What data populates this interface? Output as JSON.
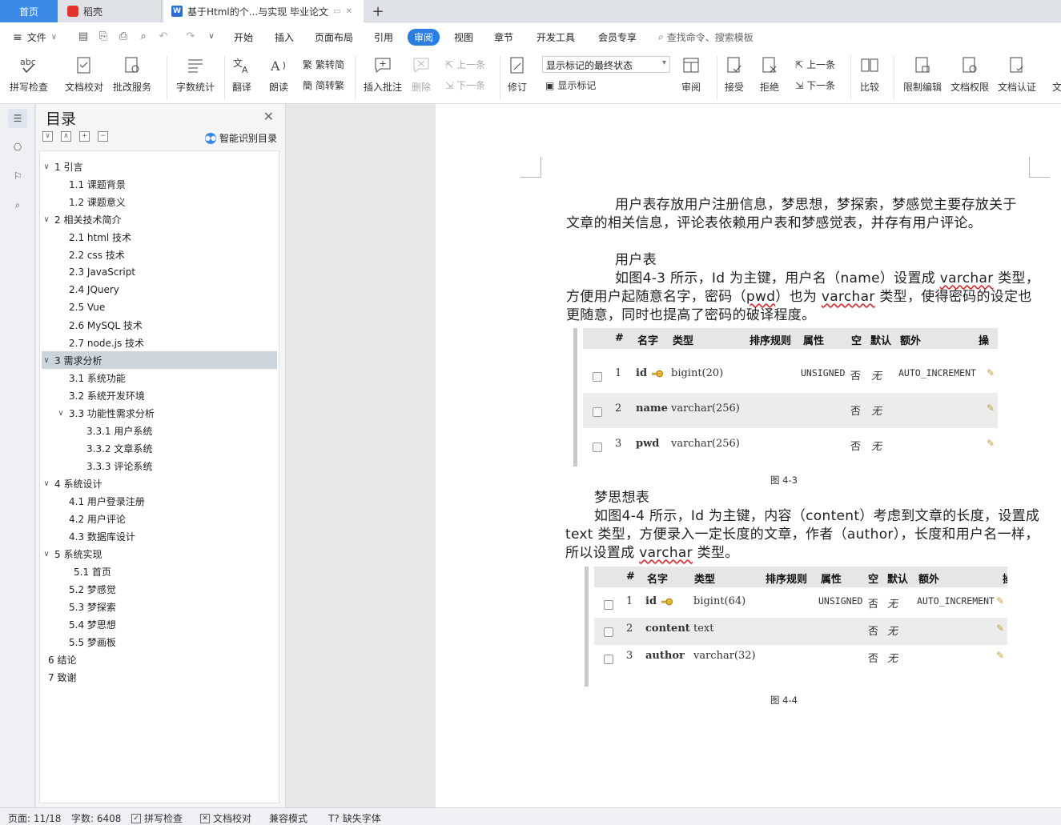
{
  "tabs": {
    "home": "首页",
    "daoke": "稻壳",
    "document": "基于Html的个...与实现 毕业论文"
  },
  "menu": {
    "file": "文件",
    "tabs": [
      "开始",
      "插入",
      "页面布局",
      "引用",
      "审阅",
      "视图",
      "章节",
      "开发工具",
      "会员专享"
    ],
    "active_tab": "审阅",
    "search": "查找命令、搜索模板"
  },
  "ribbon": {
    "spell_check": "拼写检查",
    "doc_check": "文档校对",
    "revision_service": "批改服务",
    "word_count": "字数统计",
    "translate": "翻译",
    "read_aloud": "朗读",
    "trad": "繁转简",
    "simp": "简转繁",
    "insert_comment": "插入批注",
    "delete": "删除",
    "prev": "上一条",
    "next": "下一条",
    "revise": "修订",
    "markup_state": "显示标记的最终状态",
    "show_markup": "显示标记",
    "review": "审阅",
    "accept": "接受",
    "reject": "拒绝",
    "prev2": "上一条",
    "next2": "下一条",
    "compare": "比较",
    "restrict": "限制编辑",
    "permission": "文档权限",
    "certify": "文档认证",
    "more": "文"
  },
  "toc": {
    "title": "目录",
    "smart": "智能识别目录",
    "items": [
      {
        "label": "1  引言",
        "level": 1,
        "toggle": "∨"
      },
      {
        "label": "1.1  课题背景",
        "level": 2
      },
      {
        "label": "1.2 课题意义",
        "level": 2
      },
      {
        "label": "2 相关技术简介",
        "level": 1,
        "toggle": "∨"
      },
      {
        "label": "2.1 html 技术",
        "level": 2
      },
      {
        "label": "2.2 css 技术",
        "level": 2
      },
      {
        "label": "2.3 JavaScript",
        "level": 2
      },
      {
        "label": "2.4 JQuery",
        "level": 2
      },
      {
        "label": "2.5 Vue",
        "level": 2
      },
      {
        "label": "2.6 MySQL 技术",
        "level": 2
      },
      {
        "label": "2.7 node.js 技术",
        "level": 2
      },
      {
        "label": "3 需求分析",
        "level": 1,
        "toggle": "∨",
        "selected": true
      },
      {
        "label": "3.1  系统功能",
        "level": 2
      },
      {
        "label": "3.2  系统开发环境",
        "level": 2
      },
      {
        "label": "3.3 功能性需求分析",
        "level": 2,
        "toggle": "∨"
      },
      {
        "label": "3.3.1 用户系统",
        "level": 3
      },
      {
        "label": "3.3.2  文章系统",
        "level": 3
      },
      {
        "label": "3.3.3    评论系统",
        "level": 3
      },
      {
        "label": "4  系统设计",
        "level": 1,
        "toggle": "∨"
      },
      {
        "label": "4.1  用户登录注册",
        "level": 2
      },
      {
        "label": "4.2  用户评论",
        "level": 2
      },
      {
        "label": "4.3  数据库设计",
        "level": 2
      },
      {
        "label": "5  系统实现",
        "level": 1,
        "toggle": "∨"
      },
      {
        "label": "5.1  首页",
        "level": 2,
        "indent": 1
      },
      {
        "label": "5.2  梦感觉",
        "level": 2
      },
      {
        "label": "5.3  梦探索",
        "level": 2
      },
      {
        "label": "5.4 梦思想",
        "level": 2
      },
      {
        "label": "5.5 梦画板",
        "level": 2
      },
      {
        "label": "6  结论",
        "level": 1
      },
      {
        "label": "7  致谢",
        "level": 1
      }
    ]
  },
  "doc": {
    "p1a": "用户表存放用户注册信息，梦思想，梦探索，梦感觉主要存放关于",
    "p1b": "文章的相关信息，评论表依赖用户表和梦感觉表，并存有用户评论。",
    "h_user": "用户表",
    "p2_pre": "如图",
    "p2_ref": "4-3",
    "p2_mid": "所示，",
    "p2_id": "Id",
    "p2_mid2": "为主键，用户名（",
    "p2_name": "name",
    "p2_mid3": "）设置成",
    "p2_varchar": "varchar",
    "p2_end": "类型，",
    "p3_pre": "方便用户起随意名字，密码（",
    "p3_pwd": "pwd",
    "p3_mid": "）也为",
    "p3_varchar": "varchar",
    "p3_end": "类型，使得密码的设定也",
    "p4": "更随意，同时也提高了密码的破译程度。",
    "caption1": "图 4-3",
    "h_dream": "梦思想表",
    "p5_pre": "如图",
    "p5_ref": "4-4",
    "p5_mid": "所示，",
    "p5_id": "Id",
    "p5_mid2": "为主键，内容（",
    "p5_content": "content",
    "p5_end": "）考虑到文章的长度，设置成",
    "p6_text": "text",
    "p6_mid": "类型，方便录入一定长度的文章，作者（",
    "p6_author": "author",
    "p6_end": "），长度和用户名一样，",
    "p7_pre": "所以设置成",
    "p7_varchar": "varchar",
    "p7_end": "类型。",
    "caption2": "图 4-4"
  },
  "table1": {
    "headers": [
      "#",
      "名字",
      "类型",
      "排序规则",
      "属性",
      "空",
      "默认",
      "额外",
      "操"
    ],
    "rows": [
      {
        "num": "1",
        "name": "id",
        "type": "bigint(20)",
        "attr": "UNSIGNED",
        "null": "否",
        "default": "无",
        "extra": "AUTO_INCREMENT",
        "key": true
      },
      {
        "num": "2",
        "name": "name",
        "type": "varchar(256)",
        "attr": "",
        "null": "否",
        "default": "无",
        "extra": ""
      },
      {
        "num": "3",
        "name": "pwd",
        "type": "varchar(256)",
        "attr": "",
        "null": "否",
        "default": "无",
        "extra": ""
      }
    ]
  },
  "table2": {
    "headers": [
      "#",
      "名字",
      "类型",
      "排序规则",
      "属性",
      "空",
      "默认",
      "额外",
      "操"
    ],
    "rows": [
      {
        "num": "1",
        "name": "id",
        "type": "bigint(64)",
        "attr": "UNSIGNED",
        "null": "否",
        "default": "无",
        "extra": "AUTO_INCREMENT",
        "key": true
      },
      {
        "num": "2",
        "name": "content",
        "type": "text",
        "attr": "",
        "null": "否",
        "default": "无",
        "extra": ""
      },
      {
        "num": "3",
        "name": "author",
        "type": "varchar(32)",
        "attr": "",
        "null": "否",
        "default": "无",
        "extra": ""
      }
    ]
  },
  "status": {
    "page": "页面: 11/18",
    "words": "字数: 6408",
    "spell": "拼写检查",
    "proof": "文档校对",
    "compat": "兼容模式",
    "missing_font": "缺失字体"
  },
  "colors": {
    "accent": "#2a7de1",
    "home_tab": "#3c8ae8",
    "toc_selected": "#ccd4dc"
  }
}
